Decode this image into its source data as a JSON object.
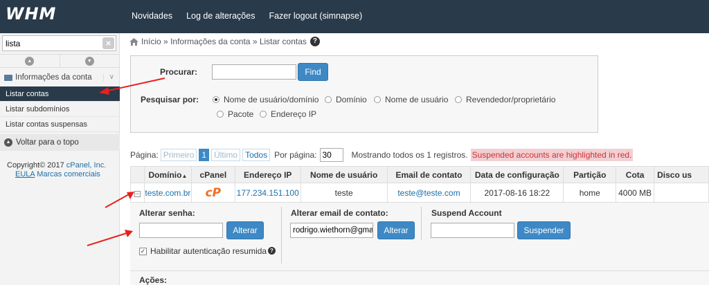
{
  "logo": "WHM",
  "top_nav": [
    "Novidades",
    "Log de alterações",
    "Fazer logout (simnapse)"
  ],
  "sidebar": {
    "search_value": "lista",
    "section_title": "Informações da conta",
    "items": [
      "Listar contas",
      "Listar subdomínios",
      "Listar contas suspensas"
    ],
    "back_to_top": "Voltar para o topo",
    "copyright": "Copyright© 2017",
    "copyright_link": "cPanel, Inc.",
    "eula": "EULA",
    "trademarks": "Marcas comerciais"
  },
  "breadcrumb": {
    "home": "Início",
    "sep": "»",
    "parent": "Informações da conta",
    "current": "Listar contas"
  },
  "search_form": {
    "find_label": "Procurar:",
    "find_button": "Find",
    "search_by_label": "Pesquisar por:",
    "options": [
      "Nome de usuário/domínio",
      "Domínio",
      "Nome de usuário",
      "Revendedor/proprietário",
      "Pacote",
      "Endereço IP"
    ],
    "selected": "Nome de usuário/domínio"
  },
  "pager": {
    "page_label": "Página:",
    "first": "Primeiro",
    "current": "1",
    "last": "Último",
    "all": "Todos",
    "per_page_label": "Por página:",
    "per_page": "30",
    "showing": "Mostrando todos os 1 registros.",
    "suspended_note": "Suspended accounts are highlighted in red."
  },
  "table": {
    "headers": [
      "Domínio",
      "cPanel",
      "Endereço IP",
      "Nome de usuário",
      "Email de contato",
      "Data de configuração",
      "Partição",
      "Cota",
      "Disco us"
    ],
    "sort_indicator": "▲",
    "row": {
      "domain": "teste.com.br",
      "cpanel_logo": "cP",
      "ip": "177.234.151.100",
      "username": "teste",
      "email": "teste@teste.com",
      "setup_date": "2017-08-16 18:22",
      "partition": "home",
      "quota": "4000 MB"
    }
  },
  "details": {
    "change_password_label": "Alterar senha:",
    "change_password_button": "Alterar",
    "digest_auth_label": "Habilitar autenticação resumida",
    "change_email_label": "Alterar email de contato:",
    "email_value": "rodrigo.wiethorn@gma",
    "change_email_button": "Alterar",
    "suspend_label": "Suspend Account",
    "suspend_button": "Suspender",
    "actions_label": "Ações:"
  },
  "colors": {
    "topbar": "#293a4a",
    "primary_button": "#3e89c5",
    "annotation_arrow": "#e8211f"
  }
}
